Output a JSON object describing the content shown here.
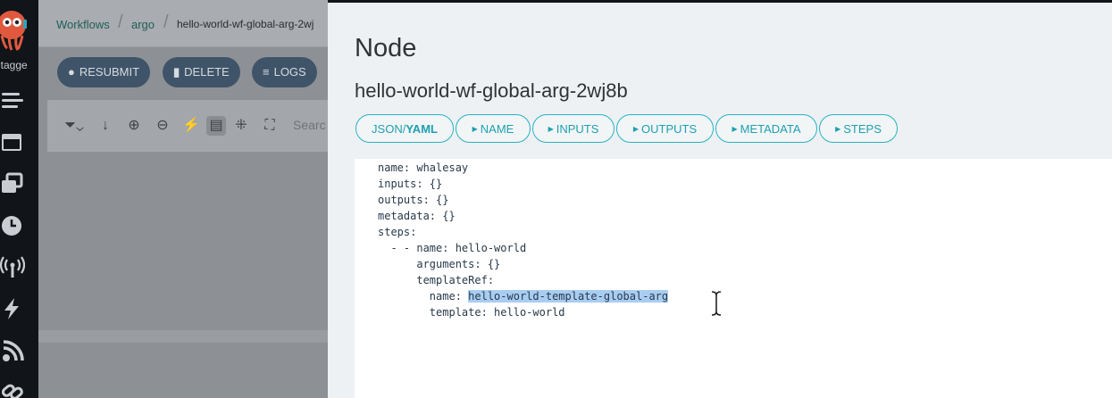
{
  "sidebar": {
    "user_fragment": "ntagge",
    "icons": [
      "logo-icon",
      "menu-icon",
      "window-icon",
      "stack-icon",
      "clock-icon",
      "antenna-icon",
      "lightning-icon",
      "feed-icon",
      "link-icon"
    ]
  },
  "breadcrumb": {
    "items": [
      "Workflows",
      "argo",
      "hello-world-wf-global-arg-2wj"
    ]
  },
  "toolbar": {
    "resubmit": "RESUBMIT",
    "delete": "DELETE",
    "logs": "LOGS"
  },
  "graph_toolbar": {
    "search_placeholder": "Searc"
  },
  "node_panel": {
    "title": "Node",
    "subtitle": "hello-world-wf-global-arg-2wj8b",
    "tabs": {
      "json_yaml_prefix": "JSON/",
      "json_yaml_bold": "YAML",
      "name": "NAME",
      "inputs": "INPUTS",
      "outputs": "OUTPUTS",
      "metadata": "METADATA",
      "steps": "STEPS"
    },
    "yaml": {
      "l1": "name: whalesay",
      "l2": "inputs: {}",
      "l3": "outputs: {}",
      "l4": "metadata: {}",
      "l5": "steps:",
      "l6": "  - - name: hello-world",
      "l7": "      arguments: {}",
      "l8": "      templateRef:",
      "l9_key": "        name: ",
      "l9_value": "hello-world-template-global-arg",
      "l10": "        template: hello-world"
    }
  },
  "colors": {
    "accent": "#27b3c5",
    "selection": "#a9cdf2",
    "toolbar_button": "#3f5468"
  }
}
